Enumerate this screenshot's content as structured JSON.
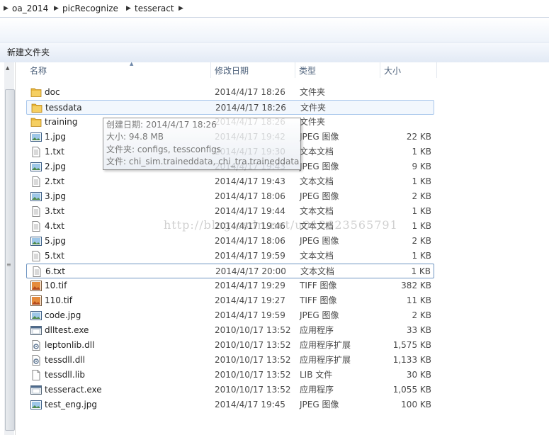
{
  "address_bar": {
    "crumbs": [
      "oa_2014",
      "picRecognize",
      "tesseract"
    ]
  },
  "toolbar": {
    "new_folder_label": "新建文件夹"
  },
  "columns": {
    "name": "名称",
    "date": "修改日期",
    "type": "类型",
    "size": "大小"
  },
  "files": [
    {
      "name": "doc",
      "date": "2014/4/17 18:26",
      "type": "文件夹",
      "size": "",
      "icon": "folder-icon"
    },
    {
      "name": "tessdata",
      "date": "2014/4/17 18:26",
      "type": "文件夹",
      "size": "",
      "icon": "folder-icon"
    },
    {
      "name": "training",
      "date": "2014/4/17 18:26",
      "type": "文件夹",
      "size": "",
      "icon": "folder-icon"
    },
    {
      "name": "1.jpg",
      "date": "2014/4/17 19:42",
      "type": "JPEG 图像",
      "size": "22 KB",
      "icon": "image-icon"
    },
    {
      "name": "1.txt",
      "date": "2014/4/17 19:30",
      "type": "文本文档",
      "size": "1 KB",
      "icon": "text-file-icon"
    },
    {
      "name": "2.jpg",
      "date": "2014/4/17 19:43",
      "type": "JPEG 图像",
      "size": "9 KB",
      "icon": "image-icon"
    },
    {
      "name": "2.txt",
      "date": "2014/4/17 19:43",
      "type": "文本文档",
      "size": "1 KB",
      "icon": "text-file-icon"
    },
    {
      "name": "3.jpg",
      "date": "2014/4/17 18:06",
      "type": "JPEG 图像",
      "size": "2 KB",
      "icon": "image-icon"
    },
    {
      "name": "3.txt",
      "date": "2014/4/17 19:44",
      "type": "文本文档",
      "size": "1 KB",
      "icon": "text-file-icon"
    },
    {
      "name": "4.txt",
      "date": "2014/4/17 19:46",
      "type": "文本文档",
      "size": "1 KB",
      "icon": "text-file-icon"
    },
    {
      "name": "5.jpg",
      "date": "2014/4/17 18:06",
      "type": "JPEG 图像",
      "size": "2 KB",
      "icon": "image-icon"
    },
    {
      "name": "5.txt",
      "date": "2014/4/17 19:59",
      "type": "文本文档",
      "size": "1 KB",
      "icon": "text-file-icon"
    },
    {
      "name": "6.txt",
      "date": "2014/4/17 20:00",
      "type": "文本文档",
      "size": "1 KB",
      "icon": "text-file-icon"
    },
    {
      "name": "10.tif",
      "date": "2014/4/17 19:29",
      "type": "TIFF 图像",
      "size": "382 KB",
      "icon": "tiff-image-icon"
    },
    {
      "name": "110.tif",
      "date": "2014/4/17 19:27",
      "type": "TIFF 图像",
      "size": "11 KB",
      "icon": "tiff-image-icon"
    },
    {
      "name": "code.jpg",
      "date": "2014/4/17 19:59",
      "type": "JPEG 图像",
      "size": "2 KB",
      "icon": "image-icon"
    },
    {
      "name": "dlltest.exe",
      "date": "2010/10/17 13:52",
      "type": "应用程序",
      "size": "33 KB",
      "icon": "application-icon"
    },
    {
      "name": "leptonlib.dll",
      "date": "2010/10/17 13:52",
      "type": "应用程序扩展",
      "size": "1,575 KB",
      "icon": "dll-icon"
    },
    {
      "name": "tessdll.dll",
      "date": "2010/10/17 13:52",
      "type": "应用程序扩展",
      "size": "1,133 KB",
      "icon": "dll-icon"
    },
    {
      "name": "tessdll.lib",
      "date": "2010/10/17 13:52",
      "type": "LIB 文件",
      "size": "30 KB",
      "icon": "blank-file-icon"
    },
    {
      "name": "tesseract.exe",
      "date": "2010/10/17 13:52",
      "type": "应用程序",
      "size": "1,055 KB",
      "icon": "application-icon"
    },
    {
      "name": "test_eng.jpg",
      "date": "2014/4/17 19:45",
      "type": "JPEG 图像",
      "size": "100 KB",
      "icon": "image-icon"
    }
  ],
  "selected_row": "tessdata",
  "focused_row": "6.txt",
  "tooltip": {
    "created": "创建日期: 2014/4/17 18:26",
    "size": "大小: 94.8 MB",
    "folders": "文件夹: configs, tessconfigs",
    "files": "文件: chi_sim.traineddata, chi_tra.traineddata, ..."
  },
  "watermark": "http://blog.csdn.net/u012623565791"
}
